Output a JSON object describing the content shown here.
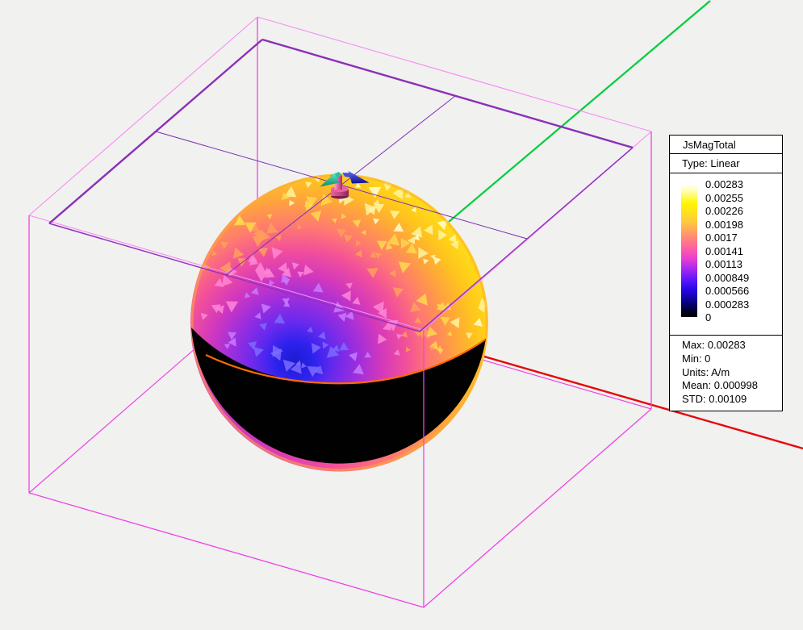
{
  "legend": {
    "title": "JsMagTotal",
    "type_label": "Type: Linear",
    "scale_values": [
      "0.00283",
      "0.00255",
      "0.00226",
      "0.00198",
      "0.0017",
      "0.00141",
      "0.00113",
      "0.000849",
      "0.000566",
      "0.000283",
      "0"
    ],
    "stats_lines": [
      "Max: 0.00283",
      "Min: 0",
      "Units: A/m",
      "Mean: 0.000998",
      "STD: 0.00109"
    ],
    "colorbar": {
      "stops": [
        "#fffff4 0%",
        "#ffffae 5%",
        "#fff600 14%",
        "#ffc93e 28%",
        "#ff8e72 39%",
        "#ff5fa2 48%",
        "#e73ed4 56%",
        "#a428f0 64%",
        "#5a17fa 72%",
        "#2807e8 79%",
        "#0d0396 87%",
        "#02023a 94%",
        "#000000 100%"
      ]
    }
  },
  "scene": {
    "background": "#f1f1f0",
    "box_color": "#ee44e4",
    "box_color_light": "#f78cf2",
    "plane_color_thick": "#8c2fb8",
    "plane_color_thin": "#9132c4",
    "plane_centerline_color": "#7d2fb0",
    "x_axis_color": "#e40808",
    "y_axis_color": "#00cd3c",
    "sphere": {
      "dark_hemisphere_color": "#010101",
      "equator_color": "#ff6a00",
      "rim_color": "#ffaa3e",
      "gradient_stops": [
        {
          "offset": "0%",
          "color": "#1c1cd0"
        },
        {
          "offset": "8%",
          "color": "#2d22ee"
        },
        {
          "offset": "16%",
          "color": "#6629ee"
        },
        {
          "offset": "26%",
          "color": "#9c2edd"
        },
        {
          "offset": "36%",
          "color": "#d238bd"
        },
        {
          "offset": "46%",
          "color": "#f24f9b"
        },
        {
          "offset": "56%",
          "color": "#ff7a70"
        },
        {
          "offset": "66%",
          "color": "#ffa140"
        },
        {
          "offset": "76%",
          "color": "#ffc61c"
        },
        {
          "offset": "86%",
          "color": "#ffdf18"
        },
        {
          "offset": "100%",
          "color": "#ffea5e"
        }
      ],
      "speckle_palette": [
        [
          70,
          "#7b6bff"
        ],
        [
          105,
          "#c87bff"
        ],
        [
          140,
          "#ff86d6"
        ],
        [
          172,
          "#ffa05a"
        ],
        [
          205,
          "#ffd84e"
        ],
        [
          400,
          "#fff59e"
        ]
      ]
    },
    "probe": {
      "cylinder_colors": [
        "#ff9ed2",
        "#ee5fa9",
        "#a62c6e"
      ],
      "teal_arrow_colors": [
        "#62e9c9",
        "#0d8a66"
      ],
      "blue_arrow_colors": [
        "#5e6cf5",
        "#10108c"
      ]
    }
  },
  "chart_data": {
    "type": "heatmap",
    "title": "JsMagTotal",
    "scale_type": "Linear",
    "units": "A/m",
    "colorbar_ticks": [
      0.00283,
      0.00255,
      0.00226,
      0.00198,
      0.0017,
      0.00141,
      0.00113,
      0.000849,
      0.000566,
      0.000283,
      0
    ],
    "range": [
      0,
      0.00283
    ],
    "stats": {
      "max": 0.00283,
      "min": 0,
      "mean": 0.000998,
      "std": 0.00109
    },
    "geometry": "surface current magnitude plotted on a sphere; upper hemisphere graded yellow(max)-to-blue, lower hemisphere at 0 (black); probe with direction arrows at top pole; magenta wireframe bounding box, purple ground-plane rectangle with centerlines, red X axis, green Y axis"
  }
}
